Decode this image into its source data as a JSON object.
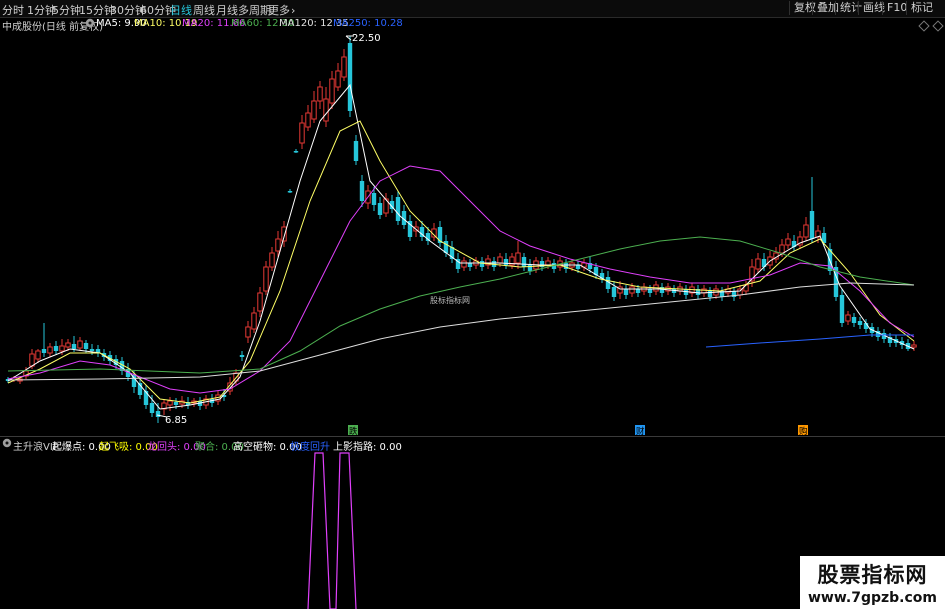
{
  "toolbar": {
    "periods": [
      "分时",
      "1分钟",
      "5分钟",
      "15分钟",
      "30分钟",
      "60分钟",
      "日线",
      "周线",
      "月线",
      "多周期",
      "更多"
    ],
    "more_icon": "chevron-right-icon",
    "active_period": "日线",
    "right_buttons": [
      "复权",
      "叠加",
      "统计",
      "画线",
      "F10",
      "标记"
    ]
  },
  "info": {
    "stock_title": "中成股份(日线 前复权)",
    "ma5": "MA5: 9.90",
    "ma10": "MA10: 10.19",
    "ma20": "MA20: 11.66",
    "ma60": "MA60: 12.30",
    "ma120": "MA120: 12.35",
    "ma250": "MA250: 10.28",
    "colors": {
      "ma5": "#ffffff",
      "ma10": "#ffff66",
      "ma20": "#e040fb",
      "ma60": "#4caf50",
      "ma120": "#ffffff",
      "ma250": "#2962ff"
    }
  },
  "chart": {
    "high_label": "22.50",
    "low_label": "6.85",
    "center_watermark": "股标指标网",
    "event_markers": [
      {
        "label": "跌",
        "color": "#4caf50"
      },
      {
        "label": "财",
        "color": "#2196f3"
      },
      {
        "label": "购",
        "color": "#ff9800"
      }
    ],
    "colors": {
      "up": "#e53935",
      "down": "#26c6da",
      "ma5": "#ffffff",
      "ma10": "#ffff66",
      "ma20": "#e040fb",
      "ma60": "#4caf50",
      "ma120": "#dddddd",
      "ma250": "#2962ff"
    }
  },
  "indicator": {
    "name": "主升浪VIP",
    "items": [
      {
        "text": "起爆点: 0.00",
        "color": "#ffffff"
      },
      {
        "text": "起飞吸: 0.00",
        "color": "#ffff00"
      },
      {
        "text": "龙回头: 0.00",
        "color": "#e040fb"
      },
      {
        "text": "聚合: 0.00",
        "color": "#4caf50"
      },
      {
        "text": "高空砸物: 0.00",
        "color": "#ffffff"
      },
      {
        "text": "极度回升",
        "color": "#2962ff"
      },
      {
        "text": "上影指路: 0.00",
        "color": "#ffffff"
      }
    ],
    "pulse_color": "#e040fb"
  },
  "watermark": {
    "line1": "股票指标网",
    "line2": "www.7gpzb.com"
  }
}
